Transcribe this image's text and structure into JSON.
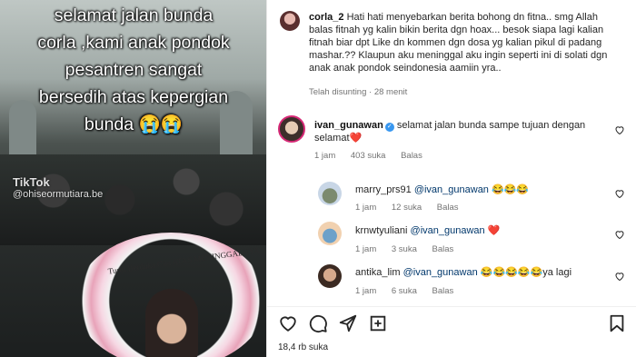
{
  "media": {
    "caption_lines": [
      "selamat jalan bunda",
      "corla ,kami anak pondok",
      "pesantren sangat",
      "bersedih atas kepergian",
      "bunda 😭😭"
    ],
    "tiktok_brand": "TikTok",
    "tiktok_handle": "@ohiseormutiara.be",
    "wreath_text": "Turut Berduka Cita ATAS MENINGGALNYA"
  },
  "main_comment": {
    "username": "corla_2",
    "text": "Hati hati menyebarkan berita bohong dn fitna.. smg Allah balas fitnah yg kalin bikin berita dgn hoax... besok siapa lagi kalian fitnah biar dpt Like dn kommen dgn dosa yg kalian pikul di padang mashar.?? Klaupun aku meninggal aku ingin seperti ini di solati dgn anak anak pondok seindonesia aamiin yra..",
    "meta": "Telah disunting · 28 menit"
  },
  "comment_ivan": {
    "username": "ivan_gunawan",
    "text": "selamat jalan bunda sampe tujuan dengan selamat❤️",
    "time": "1 jam",
    "likes": "403 suka",
    "reply": "Balas"
  },
  "replies": [
    {
      "username": "marry_prs91",
      "mention": "@ivan_gunawan",
      "text": "😂😂😂",
      "time": "1 jam",
      "likes": "12 suka",
      "reply": "Balas"
    },
    {
      "username": "krnwtyuliani",
      "mention": "@ivan_gunawan",
      "text": "❤️",
      "time": "1 jam",
      "likes": "3 suka",
      "reply": "Balas"
    },
    {
      "username": "antika_lim",
      "mention": "@ivan_gunawan",
      "text": "😂😂😂😂😂ya lagi",
      "time": "1 jam",
      "likes": "6 suka",
      "reply": "Balas"
    }
  ],
  "footer": {
    "likes": "18,4 rb suka"
  },
  "icons": {
    "heart": "heart-icon",
    "comment": "comment-icon",
    "share": "share-icon",
    "save": "bookmark-icon"
  }
}
